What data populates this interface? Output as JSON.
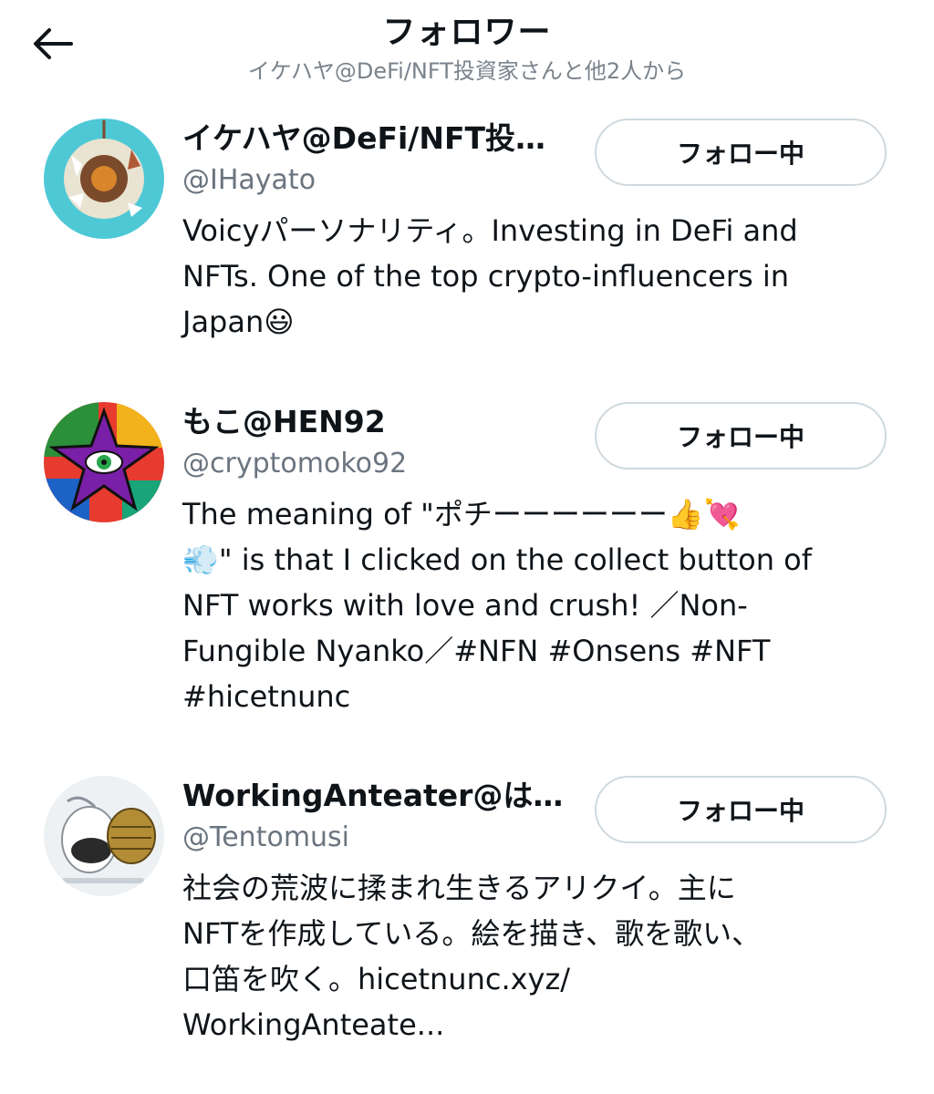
{
  "header": {
    "title": "フォロワー",
    "subtitle": "イケハヤ@DeFi/NFT投資家さんと他2人から"
  },
  "users": [
    {
      "name": "イケハヤ@DeFi/NFT投…",
      "handle": "@IHayato",
      "bio": "Voicyパーソナリティ。Investing in DeFi and\nNFTs. One of the top crypto-influencers in\nJapan😃",
      "follow_label": "フォロー中"
    },
    {
      "name": "もこ@HEN92",
      "handle": "@cryptomoko92",
      "bio": "The meaning of \"ポチーーーーーー👍💘\n💨\" is that I clicked on the collect button of\nNFT works with love and crush! ／Non-\nFungible Nyanko／#NFN #Onsens #NFT\n#hicetnunc",
      "follow_label": "フォロー中"
    },
    {
      "name": "WorkingAnteater@は…",
      "handle": "@Tentomusi",
      "bio": "社会の荒波に揉まれ生きるアリクイ。主に\nNFTを作成している。絵を描き、歌を歌い、\n口笛を吹く。hicetnunc.xyz/\nWorkingAnteate...",
      "follow_label": "フォロー中"
    }
  ]
}
